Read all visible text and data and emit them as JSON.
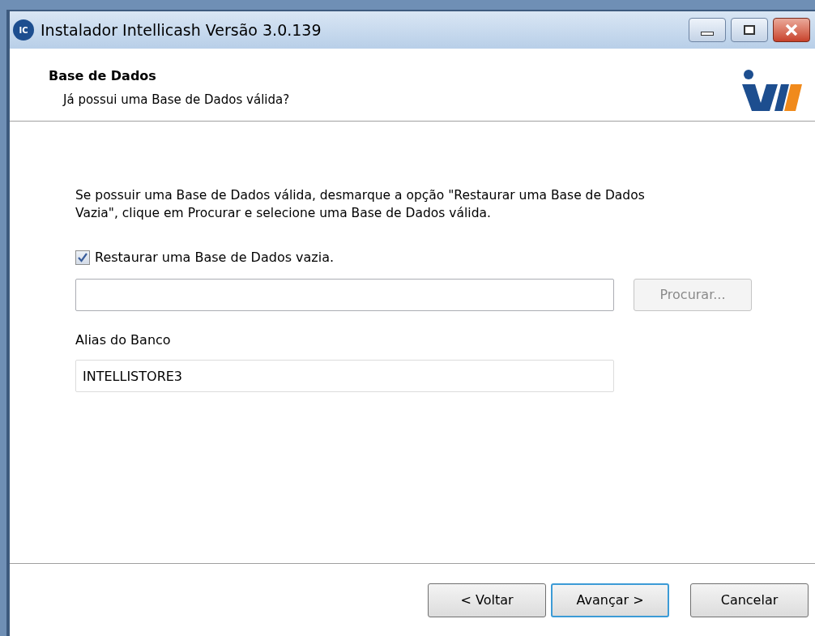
{
  "window": {
    "title": "Instalador Intellicash Versão 3.0.139",
    "app_icon": "IC"
  },
  "header": {
    "title": "Base de Dados",
    "subtitle": "Já possui uma Base de Dados válida?"
  },
  "description": "Se possuir uma Base de Dados válida, desmarque a opção \"Restaurar uma Base de Dados Vazia\", clique em Procurar e selecione uma Base de Dados válida.",
  "restore_checkbox": {
    "label": "Restaurar uma Base de Dados vazia.",
    "checked": true
  },
  "browse_button": {
    "label": "Procurar...",
    "disabled": true
  },
  "alias": {
    "label": "Alias do Banco",
    "value": "INTELLISTORE3"
  },
  "buttons": [
    {
      "label": "< Voltar",
      "default": false
    },
    {
      "label": "Avançar >",
      "default": true
    },
    {
      "label": "Cancelar",
      "default": false
    }
  ]
}
